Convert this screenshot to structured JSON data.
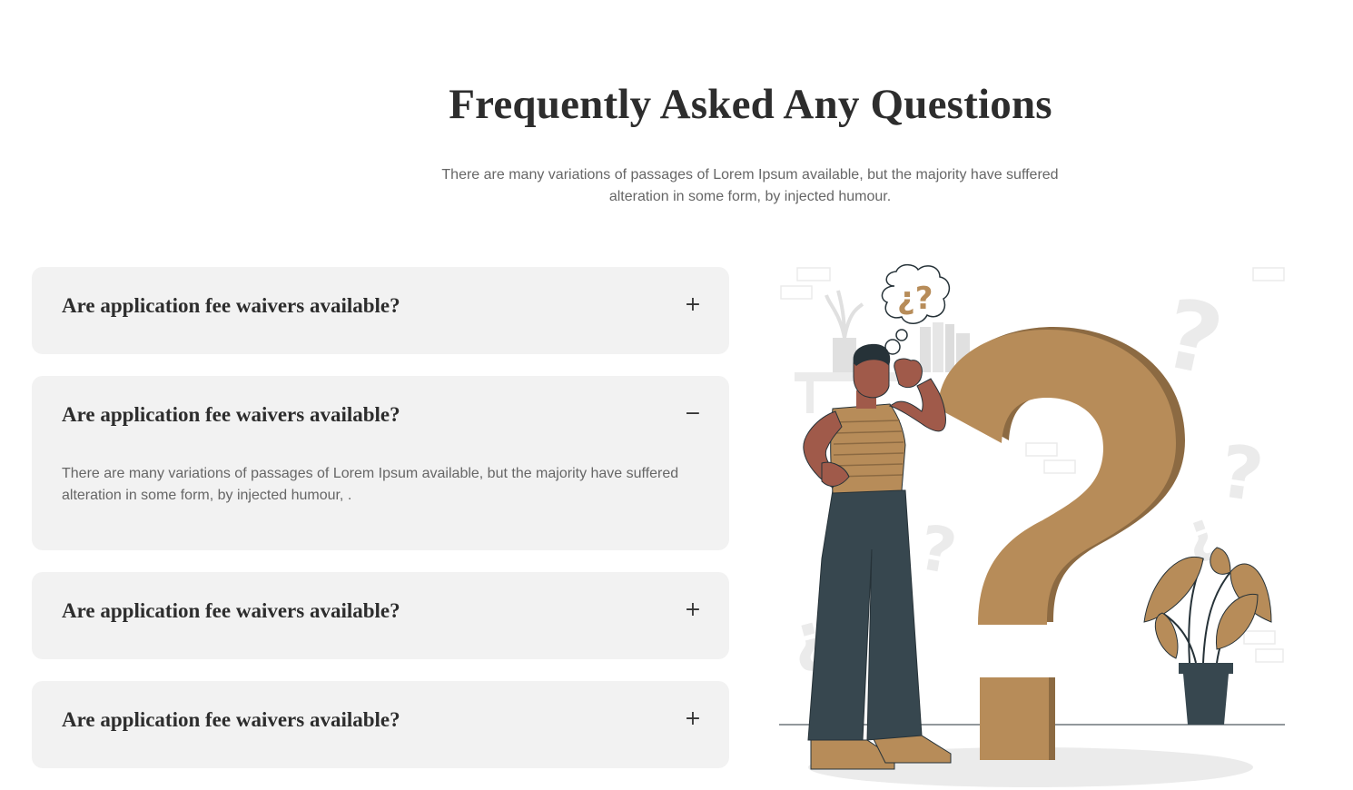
{
  "section": {
    "title": "Frequently Asked Any Questions",
    "subtitle": "There are many variations of passages of Lorem Ipsum available, but the majority have suffered alteration in some form, by injected humour."
  },
  "faq": [
    {
      "question": "Are application fee waivers available?",
      "toggle": "+",
      "expanded": false,
      "answer": ""
    },
    {
      "question": "Are application fee waivers available?",
      "toggle": "−",
      "expanded": true,
      "answer": "There are many variations of passages of Lorem Ipsum available, but the majority have suffered alteration in some form, by injected humour, ."
    },
    {
      "question": "Are application fee waivers available?",
      "toggle": "+",
      "expanded": false,
      "answer": ""
    },
    {
      "question": "Are application fee waivers available?",
      "toggle": "+",
      "expanded": false,
      "answer": ""
    }
  ],
  "illustration": {
    "bubble_text": "¿?",
    "colors": {
      "accent": "#b78c59",
      "accent_dark": "#8c6a42",
      "skin": "#a05a4a",
      "pants": "#37474f",
      "light": "#ebebeb"
    }
  }
}
